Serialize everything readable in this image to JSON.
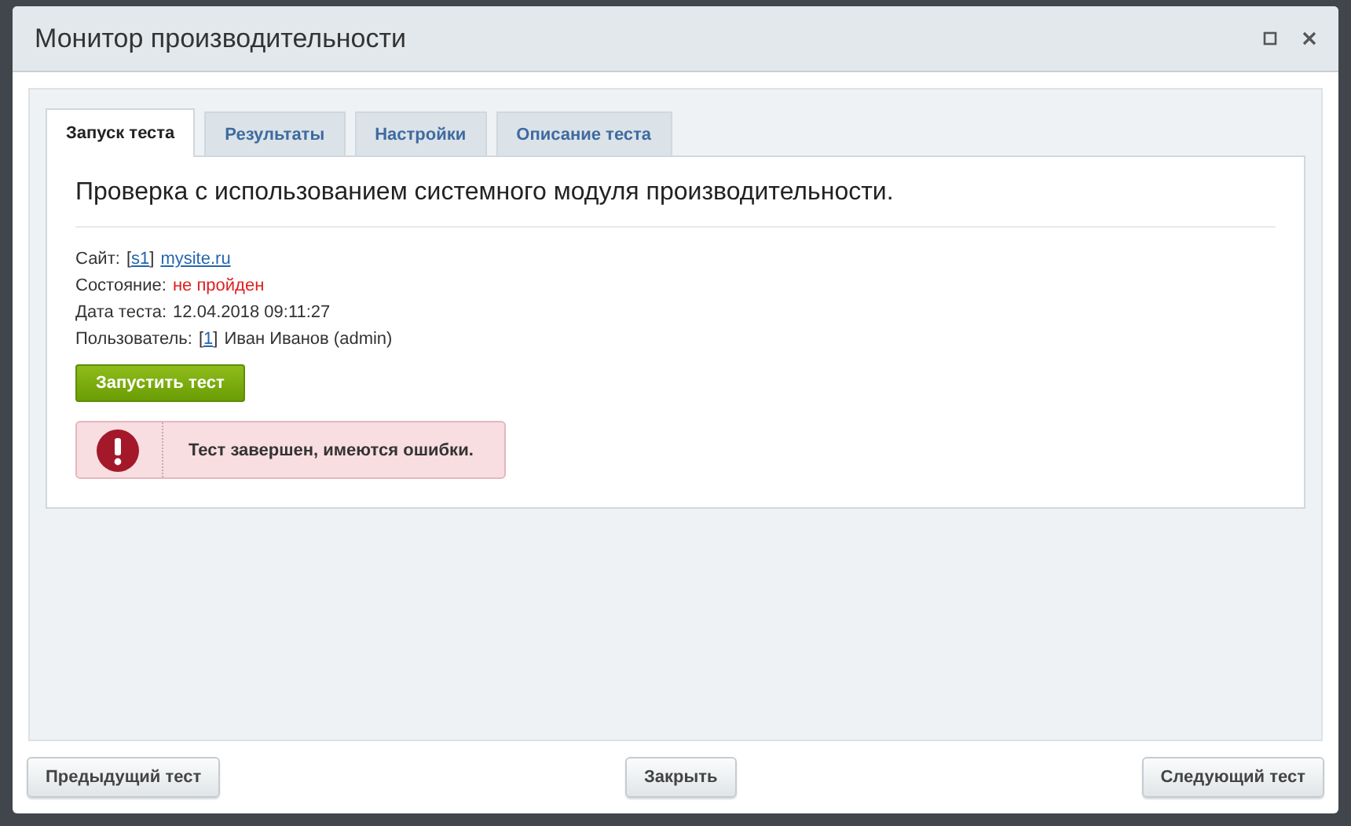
{
  "window": {
    "title": "Монитор производительности"
  },
  "tabs": [
    {
      "label": "Запуск теста",
      "selected": true
    },
    {
      "label": "Результаты",
      "selected": false
    },
    {
      "label": "Настройки",
      "selected": false
    },
    {
      "label": "Описание теста",
      "selected": false
    }
  ],
  "heading": "Проверка с использованием системного модуля производительности.",
  "info": [
    {
      "label": "Сайт:",
      "parts": [
        {
          "kind": "bracket-link",
          "open": "[",
          "text": "s1",
          "close": "]"
        },
        {
          "kind": "link",
          "text": "mysite.ru"
        }
      ]
    },
    {
      "label": "Состояние:",
      "parts": [
        {
          "kind": "error",
          "text": "не пройден"
        }
      ]
    },
    {
      "label": "Дата теста:",
      "parts": [
        {
          "kind": "text",
          "text": "12.04.2018 09:11:27"
        }
      ]
    },
    {
      "label": "Пользователь:",
      "parts": [
        {
          "kind": "bracket-link",
          "open": "[",
          "text": "1",
          "close": "]"
        },
        {
          "kind": "text",
          "text": "Иван Иванов (admin)"
        }
      ]
    }
  ],
  "run_button": "Запустить тест",
  "alert": {
    "kind": "error",
    "text": "Тест завершен, имеются ошибки."
  },
  "footer_buttons": [
    "Предыдущий тест",
    "Закрыть",
    "Следующий тест"
  ]
}
